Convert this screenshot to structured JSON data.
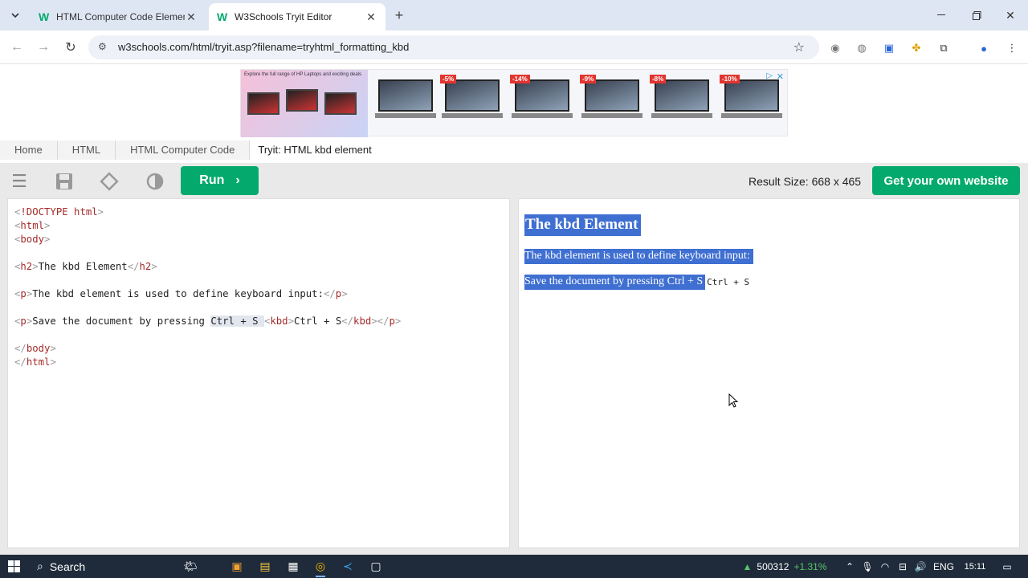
{
  "browser": {
    "tabs": [
      {
        "title": "HTML Computer Code Elements",
        "favicon": "W",
        "active": false
      },
      {
        "title": "W3Schools Tryit Editor",
        "favicon": "W",
        "active": true
      }
    ],
    "url": "w3schools.com/html/tryit.asp?filename=tryhtml_formatting_kbd"
  },
  "ad": {
    "headline": "Explore the full range of HP Laptops and exciting deals",
    "discounts": [
      "-5%",
      "-14%",
      "-9%",
      "-8%",
      "-10%"
    ]
  },
  "breadcrumbs": [
    "Home",
    "HTML",
    "HTML Computer Code",
    "Tryit: HTML kbd element"
  ],
  "editor": {
    "run_label": "Run",
    "result_size": "Result Size: 668 x 465",
    "own_website_label": "Get your own website"
  },
  "code_lines": [
    "<!DOCTYPE html>",
    "<html>",
    "<body>",
    "",
    "<h2>The kbd Element</h2>",
    "",
    "<p>The kbd element is used to define keyboard input:</p>",
    "",
    "<p>Save the document by pressing Ctrl + S <kbd>Ctrl + S</kbd></p>",
    "",
    "</body>",
    "</html>"
  ],
  "result": {
    "heading": "The kbd Element",
    "para1": "The kbd element is used to define keyboard input:",
    "para2_text": "Save the document by pressing Ctrl + S",
    "para2_kbd": "Ctrl + S"
  },
  "taskbar": {
    "search_label": "Search",
    "stock_value": "500312",
    "stock_change": "+1.31%",
    "language": "ENG",
    "time": "15:11"
  },
  "colors": {
    "accent": "#04aa6d",
    "selection": "#3f6fd1"
  }
}
